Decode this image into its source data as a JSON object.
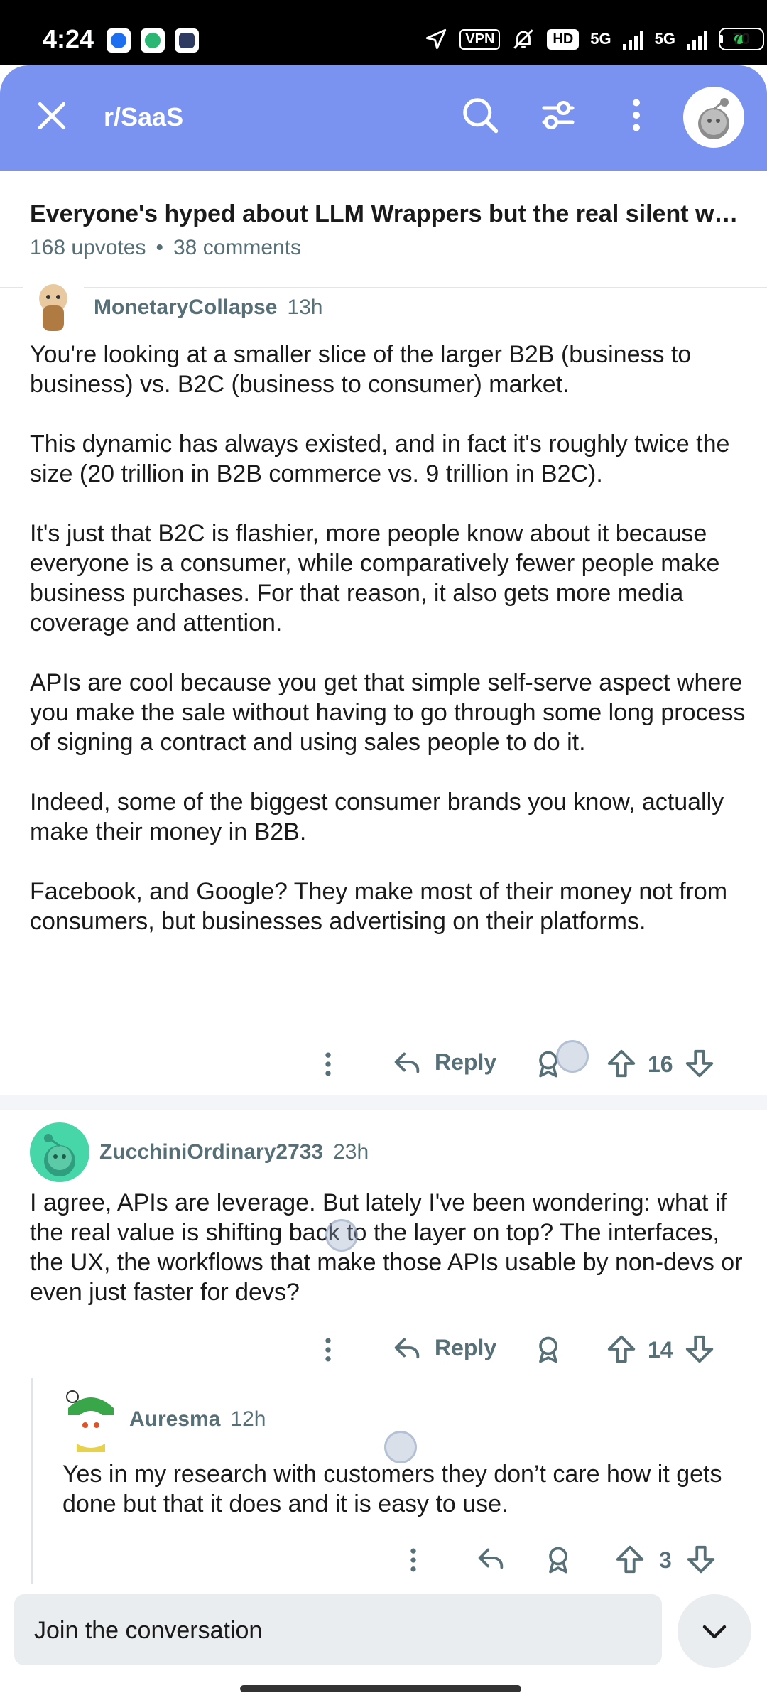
{
  "status_bar": {
    "time": "4:24",
    "vpn_label": "VPN",
    "hd_label": "HD",
    "net1": "5G",
    "net2": "5G",
    "battery": "70",
    "app_icons": [
      "messenger-icon",
      "app-icon",
      "bot-icon"
    ],
    "icons": [
      "location-icon",
      "bell-off-icon",
      "signal-icon",
      "battery-icon"
    ]
  },
  "header": {
    "subreddit": "r/SaaS",
    "icons": [
      "close-icon",
      "search-icon",
      "filter-icon",
      "more-vertical-icon",
      "avatar-icon"
    ],
    "color": "#7b93f0"
  },
  "post": {
    "title": "Everyone's hyped about LLM Wrappers but the real silent wi...",
    "upvotes": "168 upvotes",
    "comments": "38 comments"
  },
  "comments": [
    {
      "author": "MonetaryCollapse",
      "time": "13h",
      "paragraphs": [
        "You're looking at a smaller slice of the larger B2B (business to business) vs. B2C (business to consumer) market.",
        "This dynamic has always existed, and in fact it's roughly twice the size (20 trillion in B2B commerce vs. 9 trillion in B2C).",
        "It's just that B2C is flashier, more people know about it because everyone is a consumer, while comparatively fewer people make business purchases. For that reason, it also gets more media coverage and attention.",
        "APIs are cool because you get that simple self-serve aspect where you make the sale without having to go through some long process of signing a contract and using sales people to do it.",
        "Indeed, some of the biggest consumer brands you know, actually make their money in B2B.",
        "Facebook, and Google? They make most of their money not from consumers, but businesses advertising on their platforms."
      ],
      "reply_label": "Reply",
      "votes": "16"
    },
    {
      "author": "ZucchiniOrdinary2733",
      "time": "23h",
      "paragraphs": [
        "I agree, APIs are leverage. But lately I've been wondering: what if the real value is shifting back to the layer on top? The interfaces, the UX, the workflows that make those APIs usable by non-devs or even just faster for devs?"
      ],
      "reply_label": "Reply",
      "votes": "14"
    },
    {
      "author": "Auresma",
      "time": "12h",
      "paragraphs": [
        "Yes in my research with customers they don’t care how it gets done but that it does and it is easy to use."
      ],
      "votes": "3"
    }
  ],
  "bottom": {
    "placeholder": "Join the conversation"
  }
}
